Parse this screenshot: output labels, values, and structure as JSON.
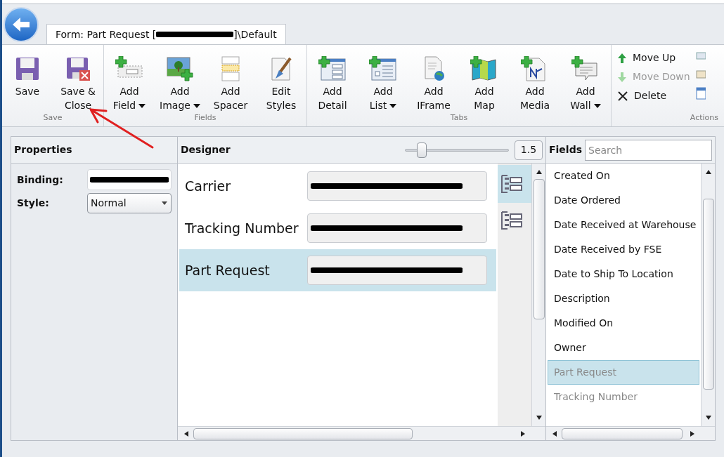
{
  "tab": {
    "title_start": "Form: Part Request [",
    "title_end": "]\\Default"
  },
  "ribbon": [
    {
      "label": "Save",
      "buttons": [
        {
          "lines": [
            "Save"
          ],
          "dropdown": false
        },
        {
          "lines": [
            "Save &",
            "Close"
          ],
          "dropdown": false
        }
      ]
    },
    {
      "label": "Fields",
      "buttons": [
        {
          "lines": [
            "Add",
            "Field"
          ],
          "dropdown": true
        },
        {
          "lines": [
            "Add",
            "Image"
          ],
          "dropdown": true
        },
        {
          "lines": [
            "Add",
            "Spacer"
          ],
          "dropdown": false
        },
        {
          "lines": [
            "Edit",
            "Styles"
          ],
          "dropdown": false
        }
      ]
    },
    {
      "label": "Tabs",
      "buttons": [
        {
          "lines": [
            "Add",
            "Detail"
          ],
          "dropdown": false
        },
        {
          "lines": [
            "Add",
            "List"
          ],
          "dropdown": true
        },
        {
          "lines": [
            "Add",
            "IFrame"
          ],
          "dropdown": false
        },
        {
          "lines": [
            "Add",
            "Map"
          ],
          "dropdown": false
        },
        {
          "lines": [
            "Add",
            "Media"
          ],
          "dropdown": false
        },
        {
          "lines": [
            "Add",
            "Wall"
          ],
          "dropdown": true
        }
      ]
    }
  ],
  "actions": {
    "label": "Actions",
    "items": [
      {
        "label": "Move Up",
        "disabled": false
      },
      {
        "label": "Move Down",
        "disabled": true
      },
      {
        "label": "Delete",
        "disabled": false
      }
    ]
  },
  "properties": {
    "title": "Properties",
    "binding_label": "Binding:",
    "style_label": "Style:",
    "style_value": "Normal"
  },
  "designer": {
    "title": "Designer",
    "zoom": {
      "level": 0.16,
      "value": "1.5"
    },
    "rows": [
      {
        "label": "Carrier",
        "selected": false
      },
      {
        "label": "Tracking Number",
        "selected": false
      },
      {
        "label": "Part Request",
        "selected": true
      }
    ]
  },
  "fields": {
    "title": "Fields",
    "placeholder": "Search",
    "items": [
      {
        "label": "Created On",
        "selected": false,
        "used": false
      },
      {
        "label": "Date Ordered",
        "selected": false,
        "used": false
      },
      {
        "label": "Date Received at Warehouse",
        "selected": false,
        "used": false
      },
      {
        "label": "Date Received by FSE",
        "selected": false,
        "used": false
      },
      {
        "label": "Date to Ship To Location",
        "selected": false,
        "used": false
      },
      {
        "label": "Description",
        "selected": false,
        "used": false
      },
      {
        "label": "Modified On",
        "selected": false,
        "used": false
      },
      {
        "label": "Owner",
        "selected": false,
        "used": false
      },
      {
        "label": "Part Request",
        "selected": true,
        "used": true
      },
      {
        "label": "Tracking Number",
        "selected": false,
        "used": true
      }
    ]
  }
}
